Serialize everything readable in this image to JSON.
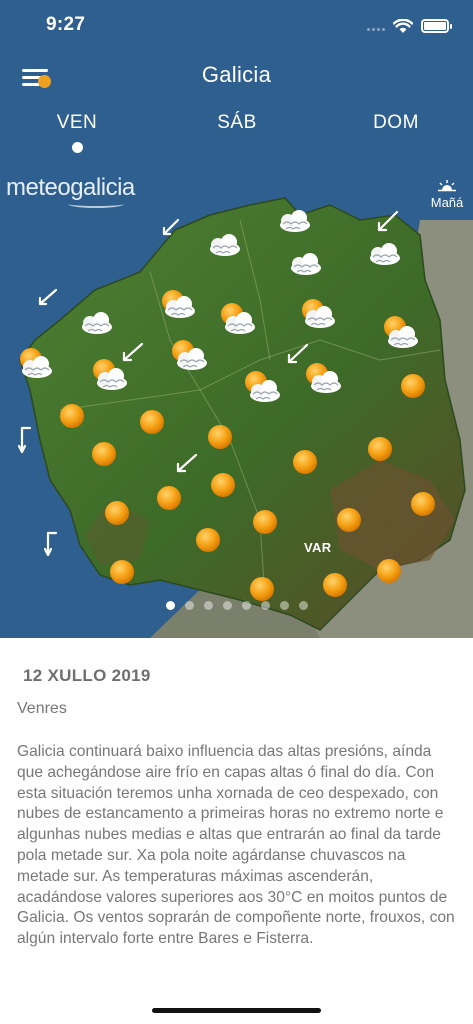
{
  "status_bar": {
    "time": "9:27"
  },
  "header": {
    "title": "Galicia"
  },
  "day_tabs": [
    {
      "label": "VEN",
      "selected": true
    },
    {
      "label": "SÁB",
      "selected": false
    },
    {
      "label": "DOM",
      "selected": false
    }
  ],
  "map": {
    "logo_text": "meteogalicia",
    "tomorrow_label": "Mañá",
    "var_label": "VAR",
    "pages": 8,
    "active_page": 0
  },
  "forecast": {
    "date": "12 XULLO 2019",
    "weekday": "Venres",
    "text": "Galicia continuará baixo influencia das altas presións, aínda que achegándose aire frío en capas altas ó final do día. Con esta situación teremos unha xornada de ceo despexado, con nubes de estancamento a primeiras horas no extremo norte e algunhas nubes medias e altas que entrarán ao final da tarde pola metade sur. Xa pola noite agárdanse chuvascos na metade sur. As temperaturas máximas ascenderán, acadándose valores superiores aos 30°C en moitos puntos de Galicia. Os ventos soprarán de compoñente norte, frouxos, con algún intervalo forte entre Bares e Fisterra."
  },
  "colors": {
    "header_blue": "#2f5f8e",
    "menu_badge": "#f0a020",
    "sun": "#f39a10",
    "land_green": "#3f6f2a",
    "outside_land": "#8a8a7a"
  }
}
